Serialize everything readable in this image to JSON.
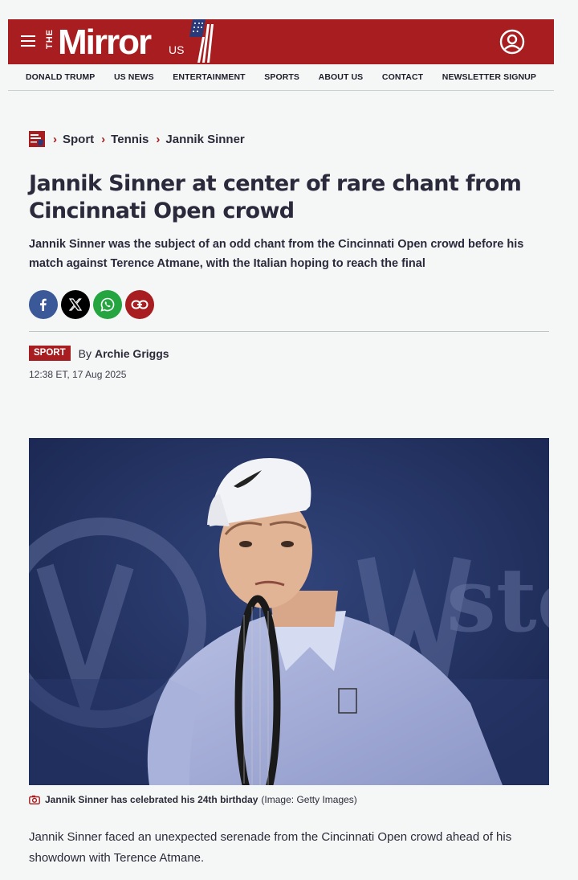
{
  "header": {
    "logo_the": "THE",
    "logo_word": "Mirror",
    "logo_us": "US"
  },
  "nav": {
    "items": [
      "DONALD TRUMP",
      "US NEWS",
      "ENTERTAINMENT",
      "SPORTS",
      "ABOUT US",
      "CONTACT",
      "NEWSLETTER SIGNUP"
    ]
  },
  "breadcrumb": {
    "items": [
      "Sport",
      "Tennis",
      "Jannik Sinner"
    ]
  },
  "article": {
    "headline": "Jannik Sinner at center of rare chant from Cincinnati Open crowd",
    "standfirst": "Jannik Sinner was the subject of an odd chant from the Cincinnati Open crowd before his match against Terence Atmane, with the Italian hoping to reach the final",
    "section_badge": "SPORT",
    "by_label": "By",
    "author": "Archie Griggs",
    "timestamp": "12:38 ET, 17 Aug 2025",
    "image_caption": "Jannik Sinner has celebrated his 24th birthday",
    "image_credit": "(Image: Getty Images)",
    "first_paragraph": "Jannik Sinner faced an unexpected serenade from the Cincinnati Open crowd ahead of his showdown with Terence Atmane."
  },
  "icons": {
    "menu": "hamburger-icon",
    "account": "user-circle-icon",
    "share": [
      "facebook-icon",
      "x-icon",
      "whatsapp-icon",
      "link-icon"
    ],
    "caption": "camera-icon"
  },
  "colors": {
    "brand_red": "#a81d20",
    "facebook": "#3b5998",
    "x": "#000000",
    "whatsapp": "#25a540"
  }
}
